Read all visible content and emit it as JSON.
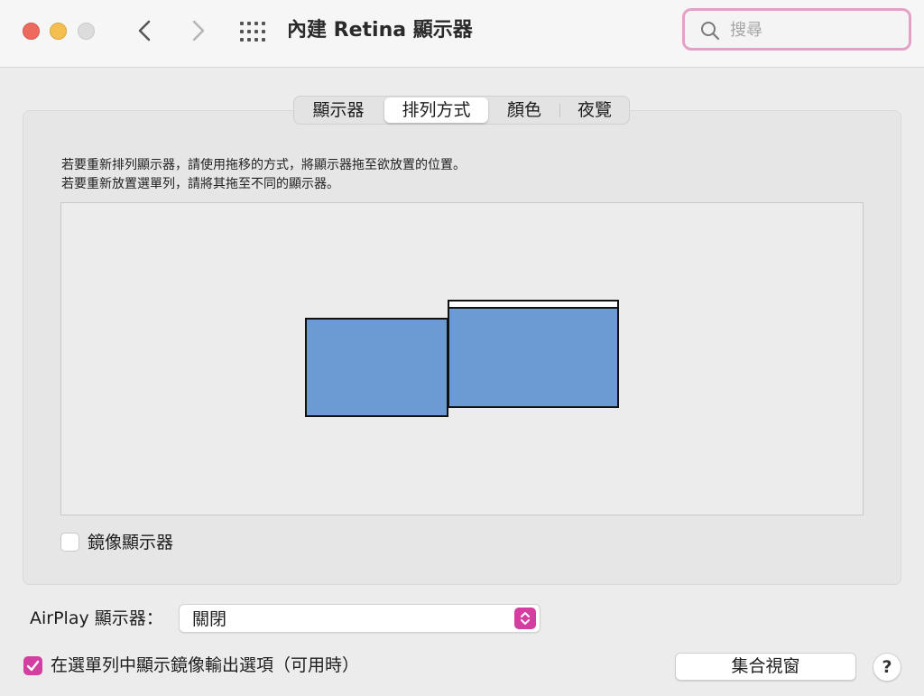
{
  "window": {
    "title": "內建 Retina 顯示器",
    "search_placeholder": "搜尋"
  },
  "tabs": [
    {
      "label": "顯示器",
      "selected": false
    },
    {
      "label": "排列方式",
      "selected": true
    },
    {
      "label": "顏色",
      "selected": false
    },
    {
      "label": "夜覽",
      "selected": false
    }
  ],
  "arrangement": {
    "instruction_line1": "若要重新排列顯示器，請使用拖移的方式，將顯示器拖至欲放置的位置。",
    "instruction_line2": "若要重新放置選單列，請將其拖至不同的顯示器。",
    "mirror_label": "鏡像顯示器",
    "mirror_checked": false
  },
  "airplay": {
    "label": "AirPlay 顯示器：",
    "value": "關閉"
  },
  "show_mirroring": {
    "label": "在選單列中顯示鏡像輸出選項（可用時）",
    "checked": true
  },
  "buttons": {
    "gather": "集合視窗",
    "help": "?"
  },
  "colors": {
    "accent": "#d33ea0",
    "display_fill": "#6b9bd2",
    "search_focus": "#e3a1c8"
  }
}
